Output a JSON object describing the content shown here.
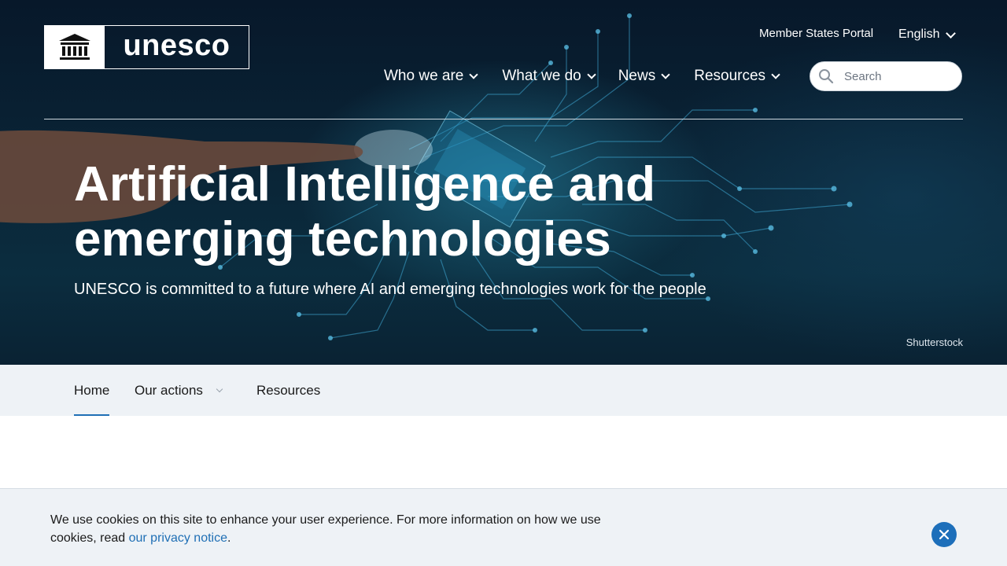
{
  "header": {
    "logo_text": "unesco",
    "utility": {
      "portal": "Member States Portal",
      "language": "English"
    },
    "nav": [
      {
        "label": "Who we are"
      },
      {
        "label": "What we do"
      },
      {
        "label": "News"
      },
      {
        "label": "Resources"
      }
    ],
    "search": {
      "placeholder": "Search"
    }
  },
  "hero": {
    "title_line1": "Artificial Intelligence and",
    "title_line2": "emerging technologies",
    "subtitle": "UNESCO is committed to a future where AI and emerging technologies work for the people",
    "credit": "Shutterstock"
  },
  "subnav": {
    "tabs": [
      {
        "label": "Home"
      },
      {
        "label": "Our actions"
      },
      {
        "label": "Resources"
      }
    ]
  },
  "cookie": {
    "text_before": "We use cookies on this site to enhance your user experience. For more information on how we use cookies, read ",
    "link": "our privacy notice",
    "text_after": "."
  },
  "icons": {
    "language_chevron": "chevron-down-icon",
    "search": "search-icon",
    "close": "close-icon"
  },
  "colors": {
    "accent": "#1f6fb5",
    "subnav_bg": "#eef2f6"
  }
}
